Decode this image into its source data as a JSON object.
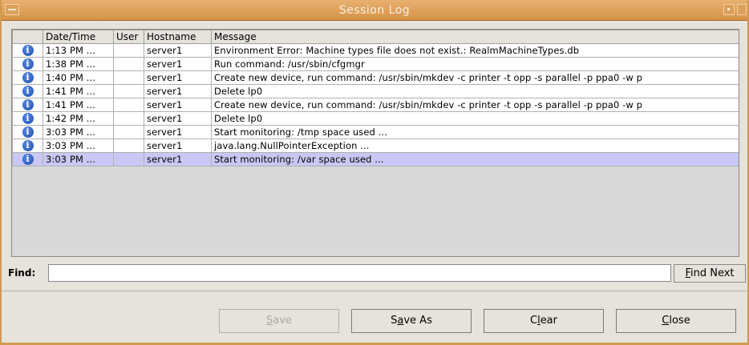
{
  "window": {
    "title": "Session Log"
  },
  "table": {
    "columns": [
      "",
      "Date/Time",
      "User",
      "Hostname",
      "Message"
    ],
    "rows": [
      {
        "icon": "info-icon",
        "datetime": "1:13 PM ...",
        "user": "",
        "hostname": "server1",
        "message": "Environment Error: Machine types file does not exist.: RealmMachineTypes.db"
      },
      {
        "icon": "info-icon",
        "datetime": "1:38 PM ...",
        "user": "",
        "hostname": "server1",
        "message": "Run command: /usr/sbin/cfgmgr"
      },
      {
        "icon": "info-icon",
        "datetime": "1:40 PM ...",
        "user": "",
        "hostname": "server1",
        "message": "Create new device, run command: /usr/sbin/mkdev -c printer -t opp -s parallel -p ppa0 -w p"
      },
      {
        "icon": "info-icon",
        "datetime": "1:41 PM ...",
        "user": "",
        "hostname": "server1",
        "message": "Delete lp0"
      },
      {
        "icon": "info-icon",
        "datetime": "1:41 PM ...",
        "user": "",
        "hostname": "server1",
        "message": "Create new device, run command: /usr/sbin/mkdev -c printer -t opp -s parallel -p ppa0 -w p"
      },
      {
        "icon": "info-icon",
        "datetime": "1:42 PM ...",
        "user": "",
        "hostname": "server1",
        "message": "Delete lp0"
      },
      {
        "icon": "info-icon",
        "datetime": "3:03 PM ...",
        "user": "",
        "hostname": "server1",
        "message": "Start monitoring: /tmp space used ..."
      },
      {
        "icon": "info-icon",
        "datetime": "3:03 PM ...",
        "user": "",
        "hostname": "server1",
        "message": "java.lang.NullPointerException ..."
      },
      {
        "icon": "info-icon",
        "datetime": "3:03 PM ...",
        "user": "",
        "hostname": "server1",
        "message": "Start monitoring: /var space used ...",
        "selected": true
      }
    ]
  },
  "find": {
    "label": "Find:",
    "value": "",
    "button": "Find Next"
  },
  "buttons": {
    "save": "Save",
    "save_as": "Save As",
    "clear": "Clear",
    "close": "Close"
  },
  "colors": {
    "titlebar": "#d59348",
    "selected_row": "#c9c8f4",
    "info_icon": "#1a4db0"
  }
}
